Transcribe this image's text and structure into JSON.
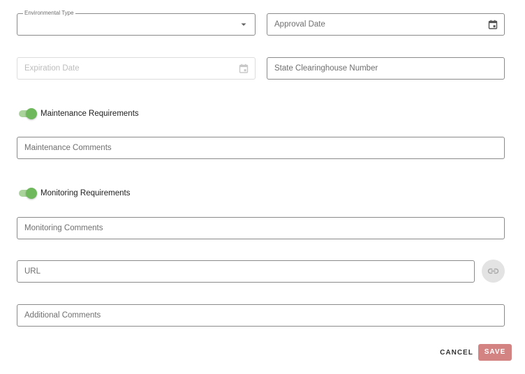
{
  "form": {
    "environmental_type": {
      "label": "Environmental Type",
      "value": "",
      "icon": "arrow-drop-down-icon"
    },
    "approval_date": {
      "placeholder": "Approval Date",
      "icon": "calendar-icon"
    },
    "expiration_date": {
      "placeholder": "Expiration Date",
      "icon": "calendar-icon",
      "disabled": true
    },
    "state_clearinghouse_number": {
      "placeholder": "State Clearinghouse Number"
    },
    "maintenance_requirements": {
      "label": "Maintenance Requirements",
      "checked": true
    },
    "maintenance_comments": {
      "placeholder": "Maintenance Comments"
    },
    "monitoring_requirements": {
      "label": "Monitoring Requirements",
      "checked": true
    },
    "monitoring_comments": {
      "placeholder": "Monitoring Comments"
    },
    "url": {
      "placeholder": "URL",
      "button_icon": "link-icon"
    },
    "additional_comments": {
      "placeholder": "Additional Comments"
    }
  },
  "actions": {
    "cancel_label": "CANCEL",
    "save_label": "SAVE"
  },
  "colors": {
    "toggle_on": "#6fb85c",
    "save_button": "#d48383"
  }
}
